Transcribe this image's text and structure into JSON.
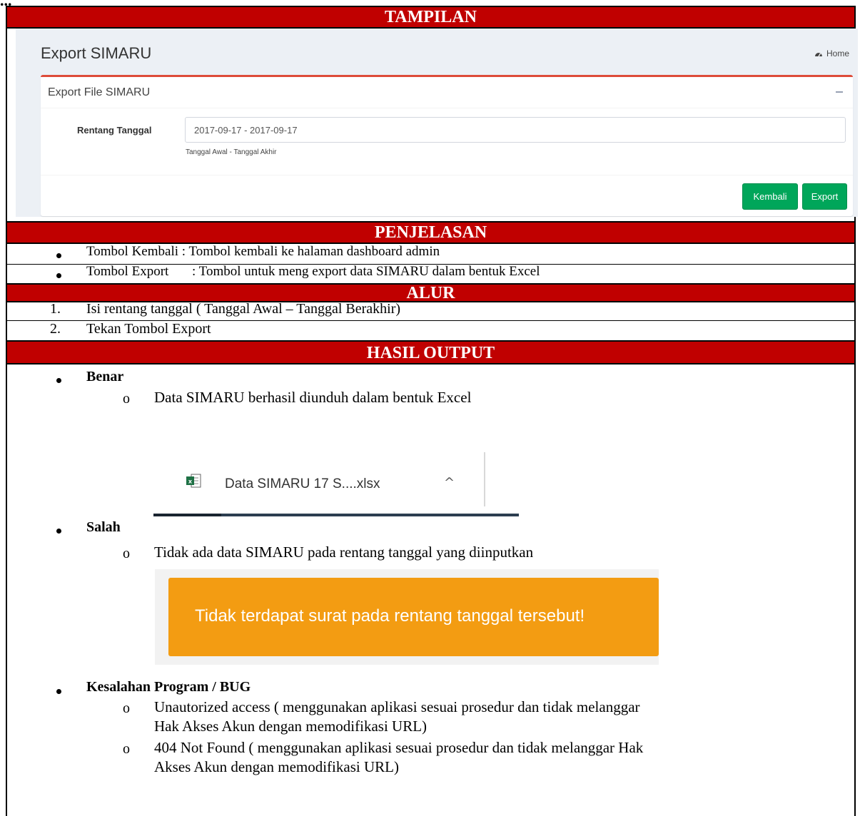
{
  "doc": {
    "top_heading": "...",
    "section_tampilan": "TAMPILAN",
    "section_penjelasan": "PENJELASAN",
    "section_alur": "ALUR",
    "section_hasil": "HASIL OUTPUT"
  },
  "app": {
    "page_title": "Export SIMARU",
    "breadcrumb_home": "Home",
    "box_title": "Export File SIMARU",
    "label_rentang": "Rentang Tanggal",
    "date_value": "2017-09-17 - 2017-09-17",
    "help_text": "Tanggal Awal - Tanggal Akhir",
    "btn_kembali": "Kembali",
    "btn_export": "Export",
    "colors": {
      "header_red": "#dd4b39",
      "btn_green": "#00a65a"
    }
  },
  "penjelasan": [
    {
      "name": "Tombol Kembali",
      "sep": ": Tombol kembali ke halaman dashboard admin"
    },
    {
      "name": "Tombol Export",
      "sep": ": Tombol untuk meng export data SIMARU dalam bentuk Excel"
    }
  ],
  "alur": [
    {
      "num": "1.",
      "text": "Isi rentang tanggal ( Tanggal Awal – Tanggal Berakhir)"
    },
    {
      "num": "2.",
      "text": "Tekan Tombol Export"
    }
  ],
  "hasil": {
    "benar_label": "Benar",
    "benar_desc": "Data SIMARU berhasil diunduh dalam bentuk Excel",
    "download_name": "Data SIMARU 17 S....xlsx",
    "salah_label": "Salah",
    "salah_desc": "Tidak ada data SIMARU pada rentang tanggal yang diinputkan",
    "alert_text": "Tidak terdapat surat pada rentang tanggal tersebut!",
    "bug_label": "Kesalahan Program / BUG",
    "bug_items": [
      {
        "line1": "Unautorized access ( menggunakan aplikasi sesuai prosedur dan tidak melanggar",
        "line2": "Hak Akses Akun dengan memodifikasi URL)"
      },
      {
        "line1": "404 Not Found ( menggunakan aplikasi sesuai prosedur dan tidak melanggar Hak",
        "line2": "Akses Akun dengan memodifikasi URL)"
      }
    ],
    "alert_color": "#f39c12"
  }
}
